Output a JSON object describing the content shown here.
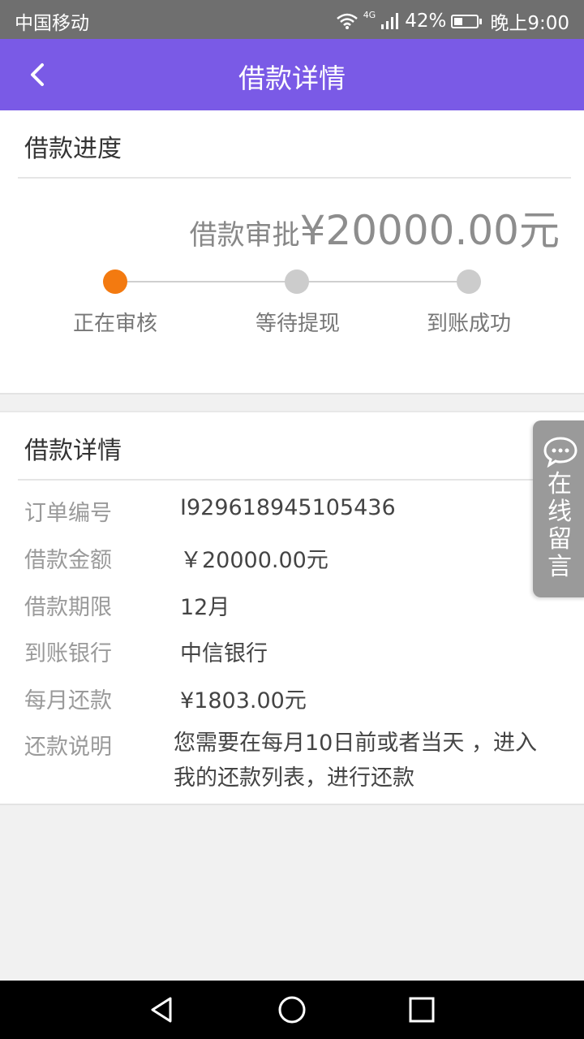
{
  "status_bar": {
    "carrier": "中国移动",
    "network": "4G",
    "battery": "42%",
    "time": "晚上9:00"
  },
  "header": {
    "title": "借款详情",
    "back_icon": "chevron-left-icon"
  },
  "progress": {
    "section_title": "借款进度",
    "approval_label": "借款审批",
    "approval_amount": "¥20000.00元",
    "steps": [
      {
        "label": "正在审核",
        "state": "active"
      },
      {
        "label": "等待提现",
        "state": "pending"
      },
      {
        "label": "到账成功",
        "state": "pending"
      }
    ],
    "active_color": "#f37a10",
    "pending_color": "#cccccc"
  },
  "details": {
    "section_title": "借款详情",
    "rows": [
      {
        "label": "订单编号",
        "value": "I929618945105436"
      },
      {
        "label": "借款金额",
        "value": "￥20000.00元"
      },
      {
        "label": "借款期限",
        "value": "12月"
      },
      {
        "label": "到账银行",
        "value": "中信银行"
      },
      {
        "label": "每月还款",
        "value": "¥1803.00元"
      },
      {
        "label": "还款说明",
        "value": "您需要在每月10日前或者当天 ，进入我的还款列表，进行还款"
      }
    ]
  },
  "side_tab": {
    "icon": "chat-bubble-icon",
    "label": "在线留言"
  },
  "colors": {
    "header_bg": "#7a5ae6",
    "status_bg": "#6f6f6f"
  },
  "nav": {
    "back": "back-triangle-icon",
    "home": "home-circle-icon",
    "recents": "recents-square-icon"
  }
}
